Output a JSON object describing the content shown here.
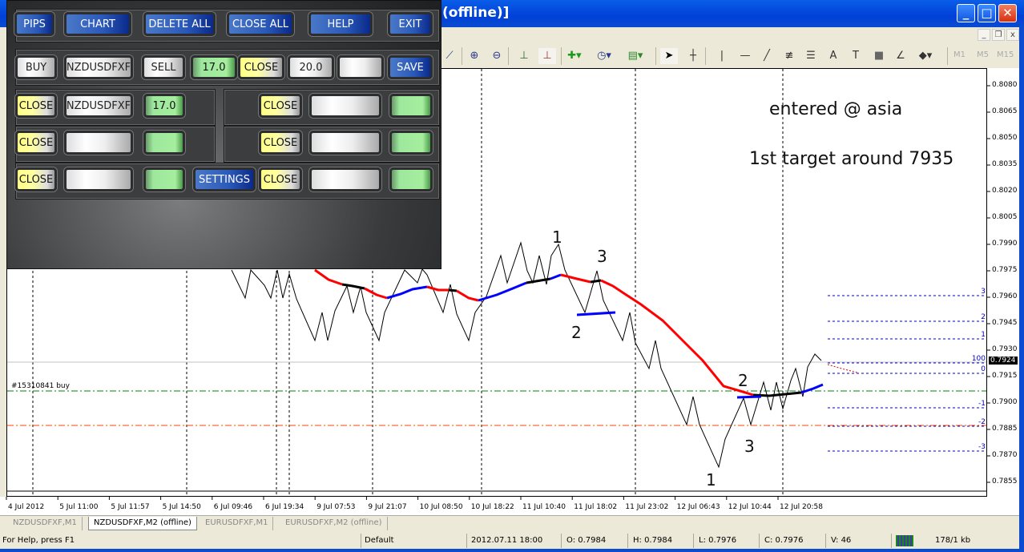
{
  "window": {
    "title": "(offline)]",
    "controls": [
      "minimize",
      "maximize",
      "close"
    ]
  },
  "toolbar": {
    "icons": [
      "line-chart-icon",
      "zoom-in-icon",
      "zoom-out-icon",
      "chart-shift-icon",
      "autoscroll-icon",
      "add-indicator-icon",
      "periods-clock-icon",
      "templates-icon",
      "cursor-icon",
      "crosshair-icon",
      "vertical-line-icon",
      "horizontal-line-icon",
      "trendline-icon",
      "fibo-expansion-icon",
      "fibo-levels-icon",
      "text-icon",
      "text-label-icon",
      "rectangle-icon",
      "gann-icon",
      "arrows-icon"
    ],
    "timeframes": [
      "M1",
      "M5",
      "M15"
    ]
  },
  "panel": {
    "row1": [
      "PIPS",
      "CHART",
      "DELETE ALL",
      "CLOSE ALL",
      "HELP",
      "EXIT"
    ],
    "row2": {
      "buy": "BUY",
      "symbol": "NZDUSDFXF",
      "sell": "SELL",
      "lots": "17.0",
      "close": "CLOSE",
      "pips": "20.0",
      "blank": "",
      "save": "SAVE"
    },
    "orders": [
      {
        "close": "CLOSE",
        "symbol": "NZDUSDFXF",
        "lots": "17.0"
      },
      {
        "close": "CLOSE",
        "symbol": "",
        "lots": ""
      },
      {
        "close": "CLOSE",
        "symbol": "",
        "lots": ""
      },
      {
        "close": "CLOSE",
        "symbol": "",
        "lots": ""
      },
      {
        "close": "CLOSE",
        "symbol": "",
        "lots": ""
      },
      {
        "close": "CLOSE",
        "symbol": "",
        "lots": ""
      }
    ],
    "settings": "SETTINGS"
  },
  "chart": {
    "symbol": "NZDUSDFXF",
    "timeframe": "M2",
    "price_labels": [
      "0.8080",
      "0.8065",
      "0.8050",
      "0.8035",
      "0.8020",
      "0.8005",
      "0.7990",
      "0.7975",
      "0.7960",
      "0.7945",
      "0.7930",
      "0.7915",
      "0.7900",
      "0.7885",
      "0.7870",
      "0.7855"
    ],
    "current_price": "0.7924",
    "time_labels": [
      "4 Jul 2012",
      "5 Jul 11:00",
      "5 Jul 11:57",
      "5 Jul 14:50",
      "6 Jul 09:46",
      "6 Jul 19:34",
      "9 Jul 07:53",
      "9 Jul 21:07",
      "10 Jul 08:50",
      "10 Jul 18:22",
      "11 Jul 10:40",
      "11 Jul 18:02",
      "11 Jul 23:02",
      "12 Jul 06:43",
      "12 Jul 10:44",
      "12 Jul 20:58"
    ],
    "order_label": "#15310841 buy",
    "fib_levels": [
      "3",
      "2",
      "1",
      "100",
      "0",
      "-1",
      "-2",
      "-3"
    ],
    "wave_labels": [
      "1",
      "3",
      "2",
      "2",
      "3",
      "1"
    ],
    "notes": [
      "entered @ asia",
      "1st target around 7935"
    ],
    "colors": {
      "ma_up": "#0000ff",
      "ma_down": "#ff0000",
      "ma_flat": "#000000",
      "order_line": "#008000",
      "stop_line": "#ff4500",
      "fib": "#0000cc"
    }
  },
  "tabs": [
    {
      "label": "NZDUSDFXF,M1",
      "active": false
    },
    {
      "label": "NZDUSDFXF,M2 (offline)",
      "active": true
    },
    {
      "label": "EURUSDFXF,M1",
      "active": false
    },
    {
      "label": "EURUSDFXF,M2 (offline)",
      "active": false
    }
  ],
  "status": {
    "help": "For Help, press F1",
    "profile": "Default",
    "time": "2012.07.11 18:00",
    "open": "O: 0.7984",
    "high": "H: 0.7984",
    "low": "L: 0.7976",
    "close": "C: 0.7976",
    "volume": "V: 46",
    "traffic": "178/1 kb"
  }
}
